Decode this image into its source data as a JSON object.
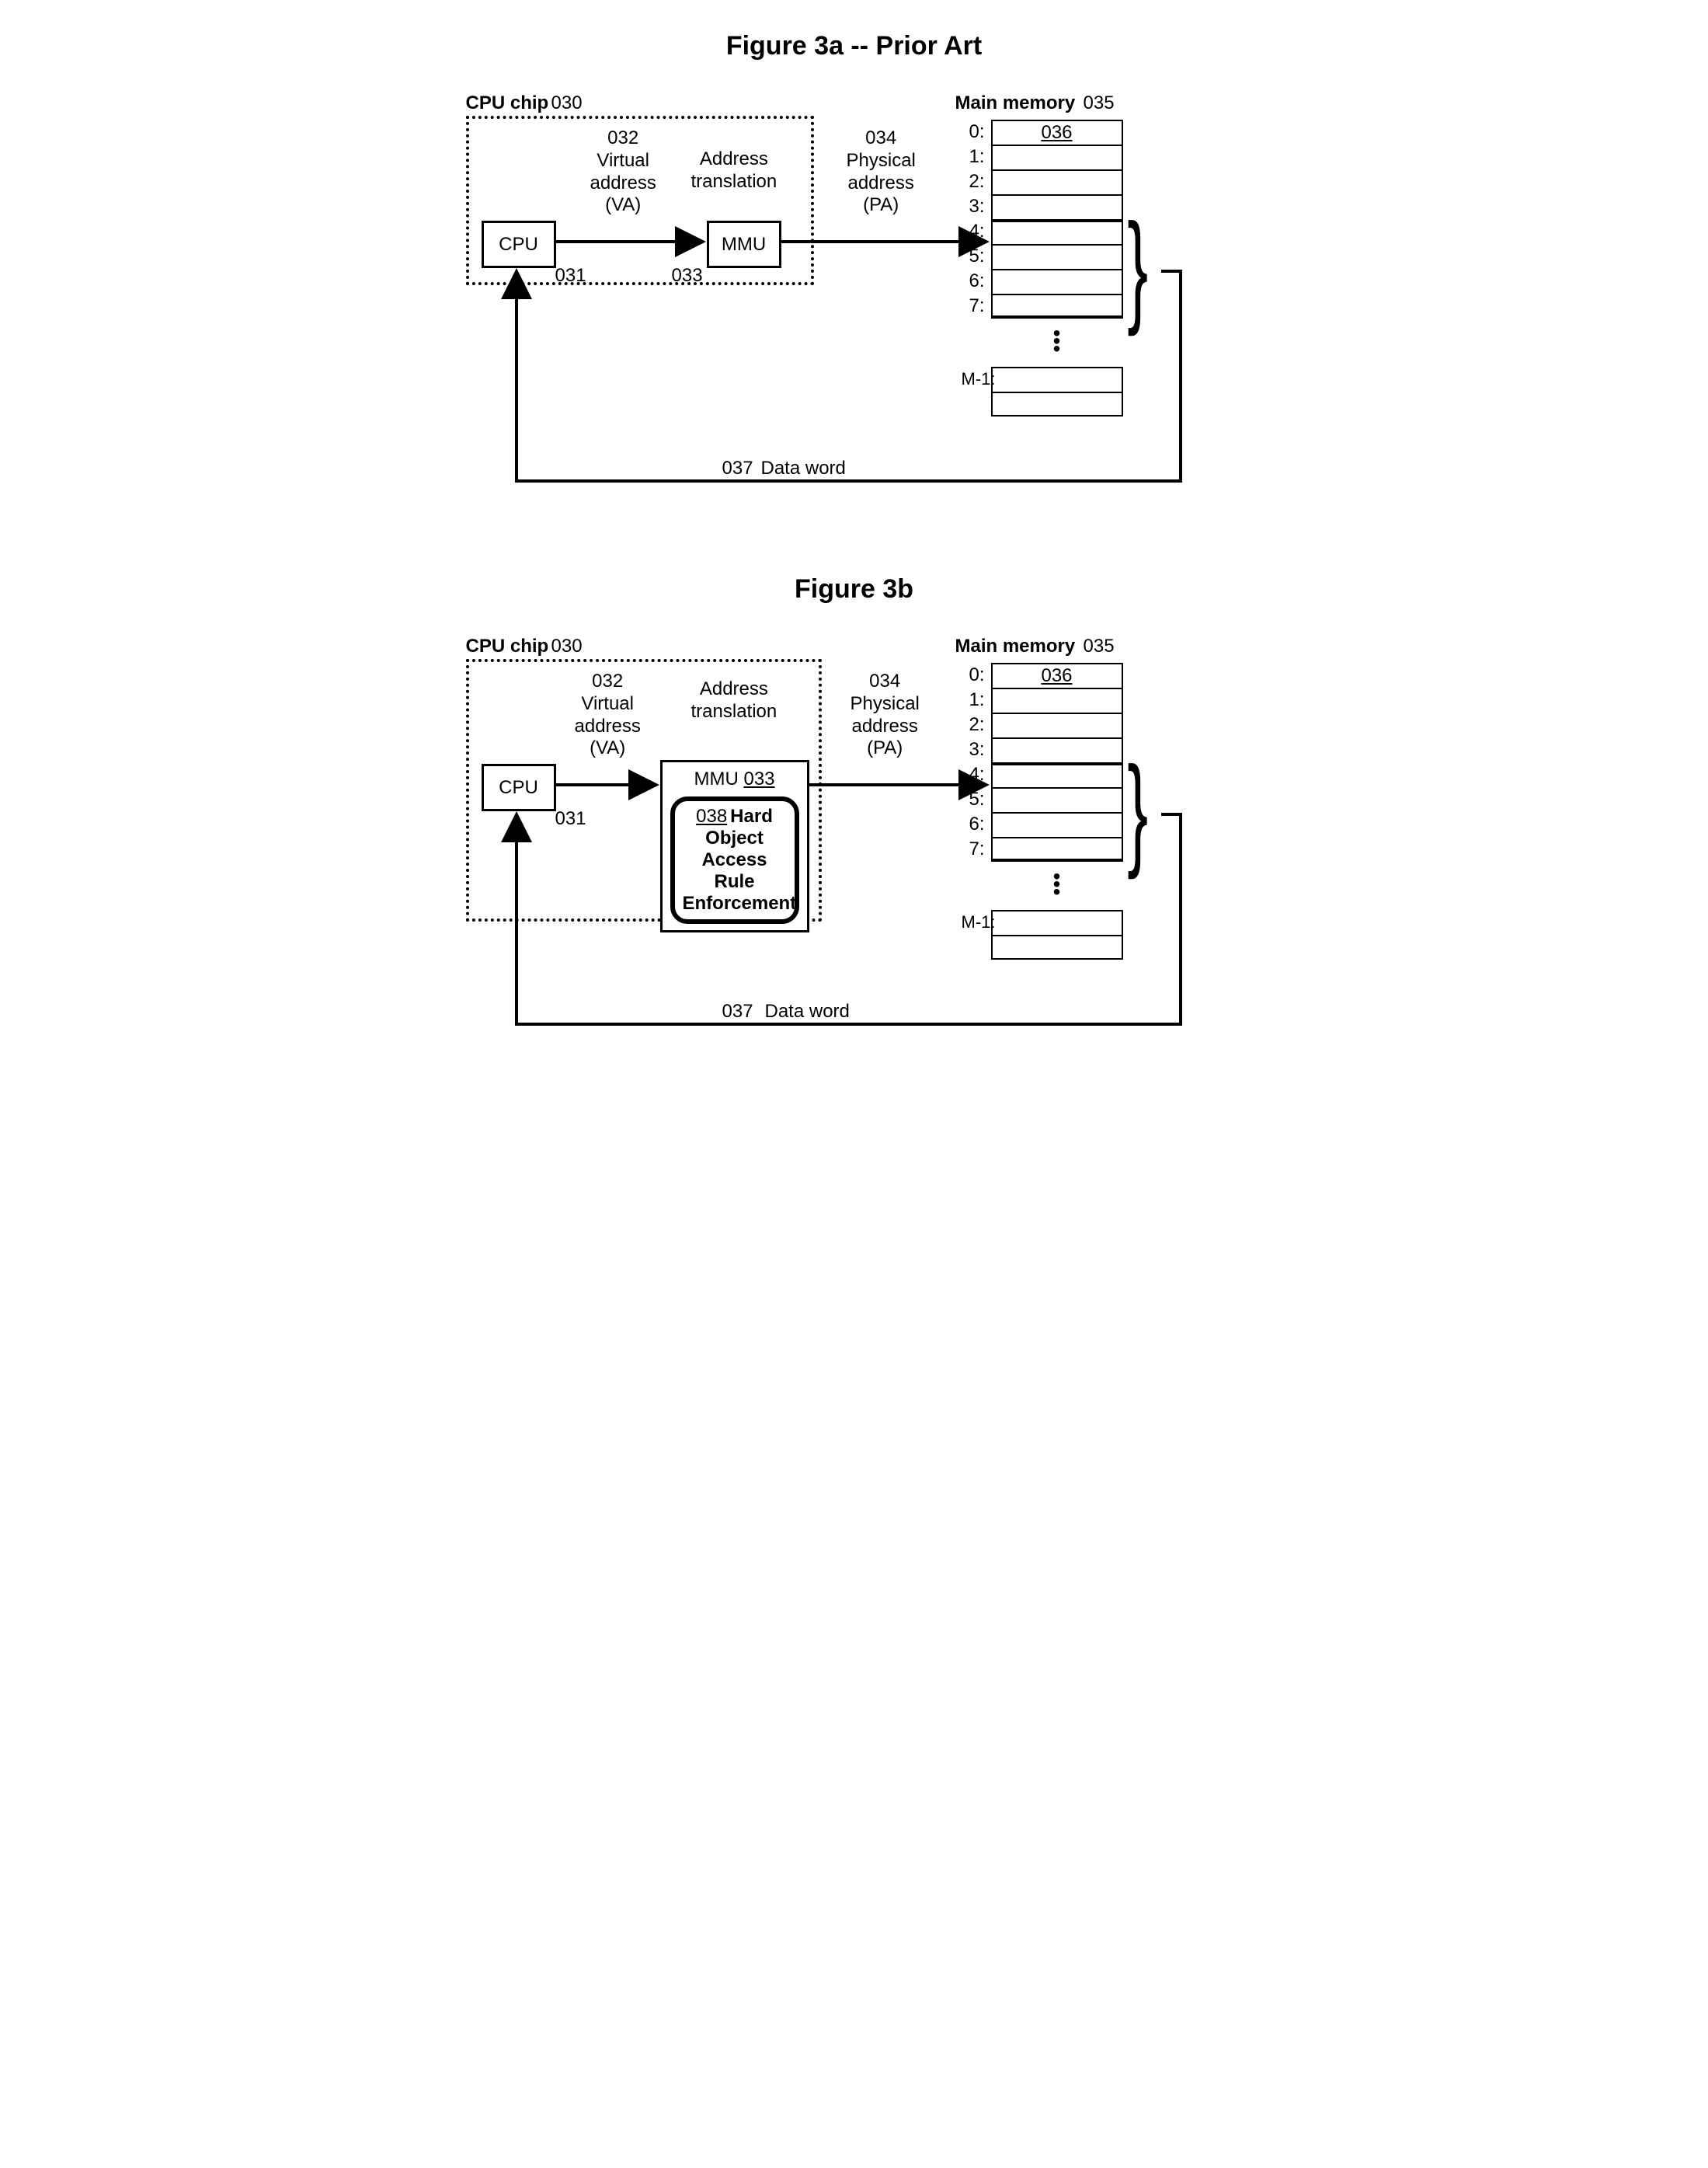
{
  "fig_a": {
    "title": "Figure 3a -- Prior Art",
    "cpu_chip_label": "CPU chip",
    "cpu_chip_ref": "030",
    "cpu_label": "CPU",
    "cpu_ref": "031",
    "va_ref": "032",
    "va_line1": "Virtual",
    "va_line2": "address",
    "va_line3": "(VA)",
    "addr_trans_line1": "Address",
    "addr_trans_line2": "translation",
    "mmu_label": "MMU",
    "mmu_ref": "033",
    "pa_ref": "034",
    "pa_line1": "Physical",
    "pa_line2": "address",
    "pa_line3": "(PA)",
    "main_mem_label": "Main memory",
    "main_mem_ref": "035",
    "mem_ref_036": "036",
    "mem_indices": [
      "0:",
      "1:",
      "2:",
      "3:",
      "4:",
      "5:",
      "6:",
      "7:"
    ],
    "mem_last_idx": "M-1:",
    "data_word_ref": "037",
    "data_word_label": "Data word"
  },
  "fig_b": {
    "title": "Figure 3b",
    "cpu_chip_label": "CPU chip",
    "cpu_chip_ref": "030",
    "cpu_label": "CPU",
    "cpu_ref": "031",
    "va_ref": "032",
    "va_line1": "Virtual",
    "va_line2": "address",
    "va_line3": "(VA)",
    "addr_trans_line1": "Address",
    "addr_trans_line2": "translation",
    "mmu_label": "MMU",
    "mmu_ref": "033",
    "pa_ref": "034",
    "pa_line1": "Physical",
    "pa_line2": "address",
    "pa_line3": "(PA)",
    "main_mem_label": "Main memory",
    "main_mem_ref": "035",
    "mem_ref_036": "036",
    "mem_indices": [
      "0:",
      "1:",
      "2:",
      "3:",
      "4:",
      "5:",
      "6:",
      "7:"
    ],
    "mem_last_idx": "M-1:",
    "data_word_ref": "037",
    "data_word_label": "Data word",
    "hard_ref": "038",
    "hard_l1": "Hard",
    "hard_l2": "Object",
    "hard_l3": "Access Rule",
    "hard_l4": "Enforcement"
  }
}
